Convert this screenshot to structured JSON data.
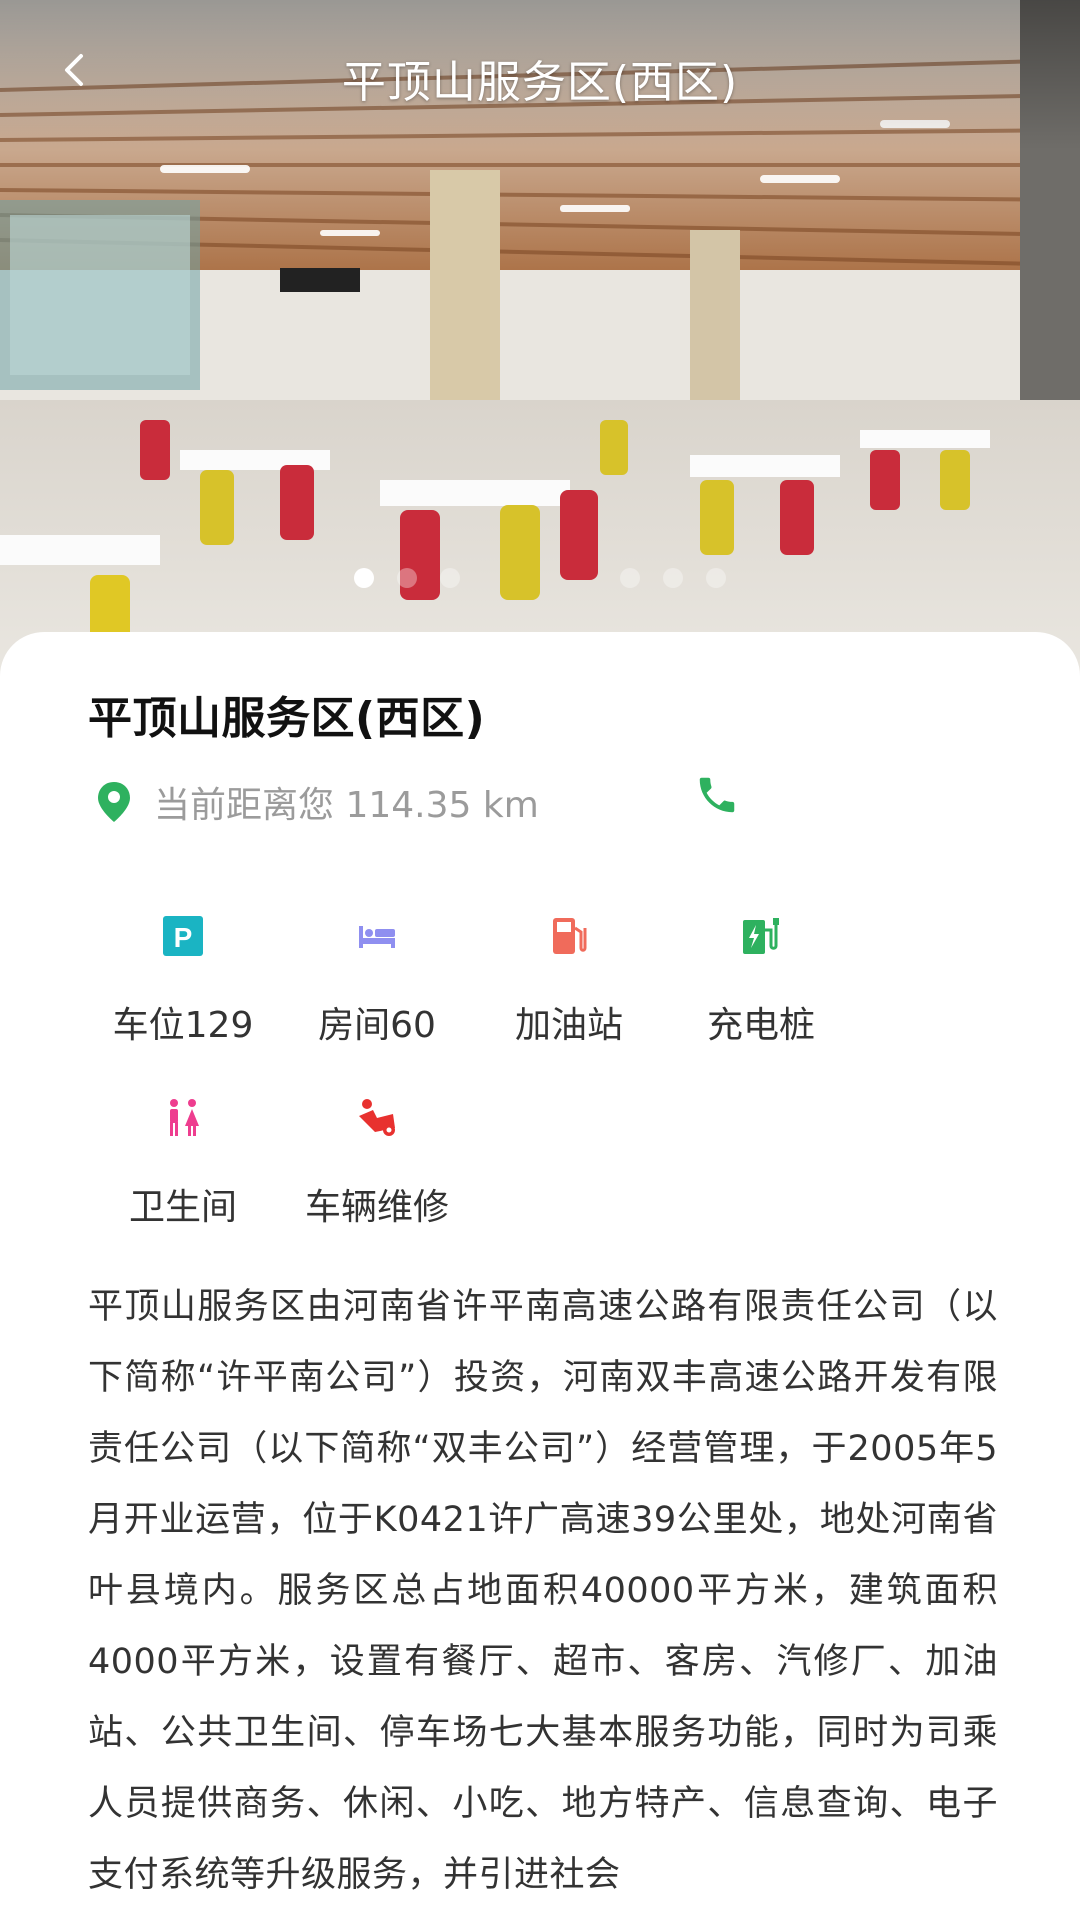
{
  "header": {
    "title": "平顶山服务区(西区)"
  },
  "carousel": {
    "total_slides": 6,
    "active_index": 0
  },
  "service_area": {
    "name": "平顶山服务区(西区)",
    "distance_text": "当前距离您 114.35 km"
  },
  "facilities": [
    {
      "label": "车位129",
      "icon": "parking-icon",
      "color": "#1ab4c3"
    },
    {
      "label": "房间60",
      "icon": "bed-icon",
      "color": "#8f8ff0"
    },
    {
      "label": "加油站",
      "icon": "fuel-pump-icon",
      "color": "#f06b5b"
    },
    {
      "label": "充电桩",
      "icon": "ev-charger-icon",
      "color": "#2eb15f"
    },
    {
      "label": "卫生间",
      "icon": "restroom-icon",
      "color": "#ee3d8f"
    },
    {
      "label": "车辆维修",
      "icon": "vehicle-repair-icon",
      "color": "#e8312f"
    }
  ],
  "description": "平顶山服务区由河南省许平南高速公路有限责任公司（以下简称“许平南公司”）投资，河南双丰高速公路开发有限责任公司（以下简称“双丰公司”）经营管理，于2005年5月开业运营，位于K0421许广高速39公里处，地处河南省叶县境内。服务区总占地面积40000平方米，建筑面积4000平方米，设置有餐厅、超市、客房、汽修厂、加油站、公共卫生间、停车场七大基本服务功能，同时为司乘人员提供商务、休闲、小吃、地方特产、信息查询、电子支付系统等升级服务，并引进社会",
  "colors": {
    "accent_green": "#2eb15f",
    "text_primary": "#111111",
    "text_secondary": "#9b9b9b"
  }
}
